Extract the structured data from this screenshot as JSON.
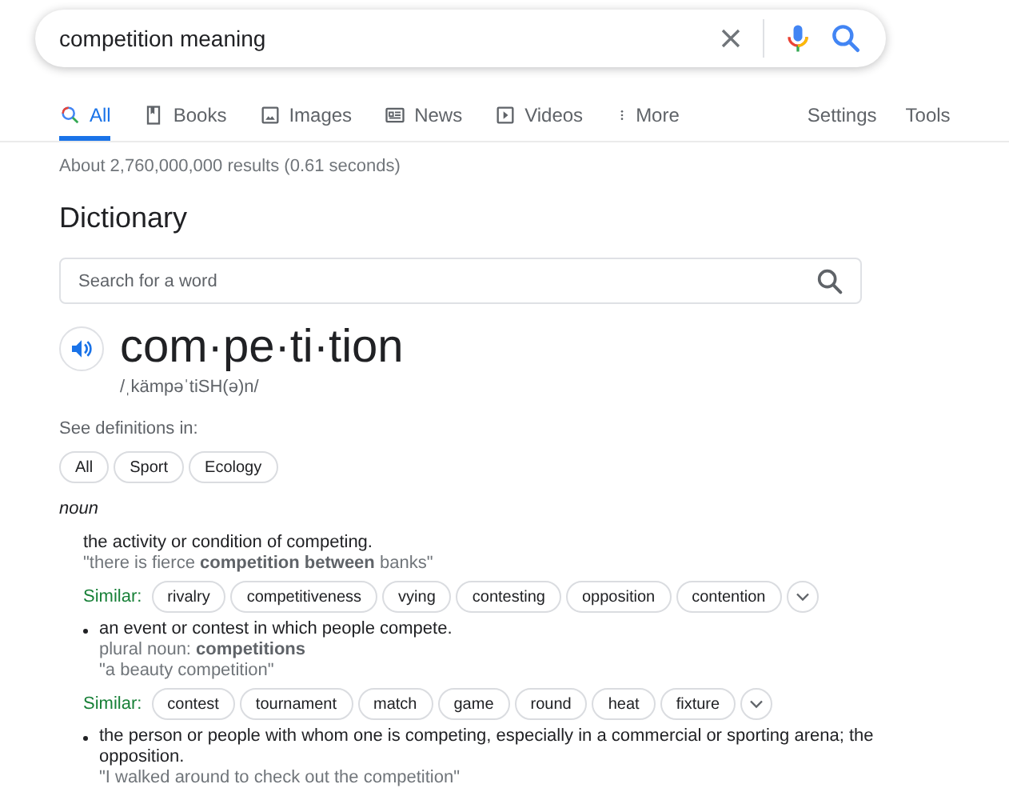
{
  "search": {
    "value": "competition meaning"
  },
  "tabs": [
    {
      "label": "All",
      "kind": "search",
      "selected": true
    },
    {
      "label": "Books",
      "kind": "book",
      "selected": false
    },
    {
      "label": "Images",
      "kind": "image",
      "selected": false
    },
    {
      "label": "News",
      "kind": "news",
      "selected": false
    },
    {
      "label": "Videos",
      "kind": "video",
      "selected": false
    },
    {
      "label": "More",
      "kind": "more",
      "selected": false
    }
  ],
  "tool_links": [
    "Settings",
    "Tools"
  ],
  "result_stats": "About 2,760,000,000 results (0.61 seconds)",
  "dictionary": {
    "heading": "Dictionary",
    "search_placeholder": "Search for a word",
    "word": "com·pe·ti·tion",
    "pronunciation": "/ˌkämpəˈtiSH(ə)n/",
    "see_definitions_label": "See definitions in:",
    "filters": [
      "All",
      "Sport",
      "Ecology"
    ],
    "part_of_speech": "noun",
    "senses": [
      {
        "kind": "plain",
        "definition": "the activity or condition of competing.",
        "example": "\"there is fierce **competition between** banks\"",
        "similar_label": "Similar:",
        "similar": [
          "rivalry",
          "competitiveness",
          "vying",
          "contesting",
          "opposition",
          "contention"
        ]
      },
      {
        "kind": "bulleted",
        "definition": "an event or contest in which people compete.",
        "grammar": "plural noun: **competitions**",
        "example": "\"a beauty competition\"",
        "similar_label": "Similar:",
        "similar": [
          "contest",
          "tournament",
          "match",
          "game",
          "round",
          "heat",
          "fixture"
        ]
      },
      {
        "kind": "bulleted",
        "definition": "the person or people with whom one is competing, especially in a commercial or sporting arena; the opposition.",
        "example": "\"I walked around to check out the competition\""
      }
    ]
  }
}
